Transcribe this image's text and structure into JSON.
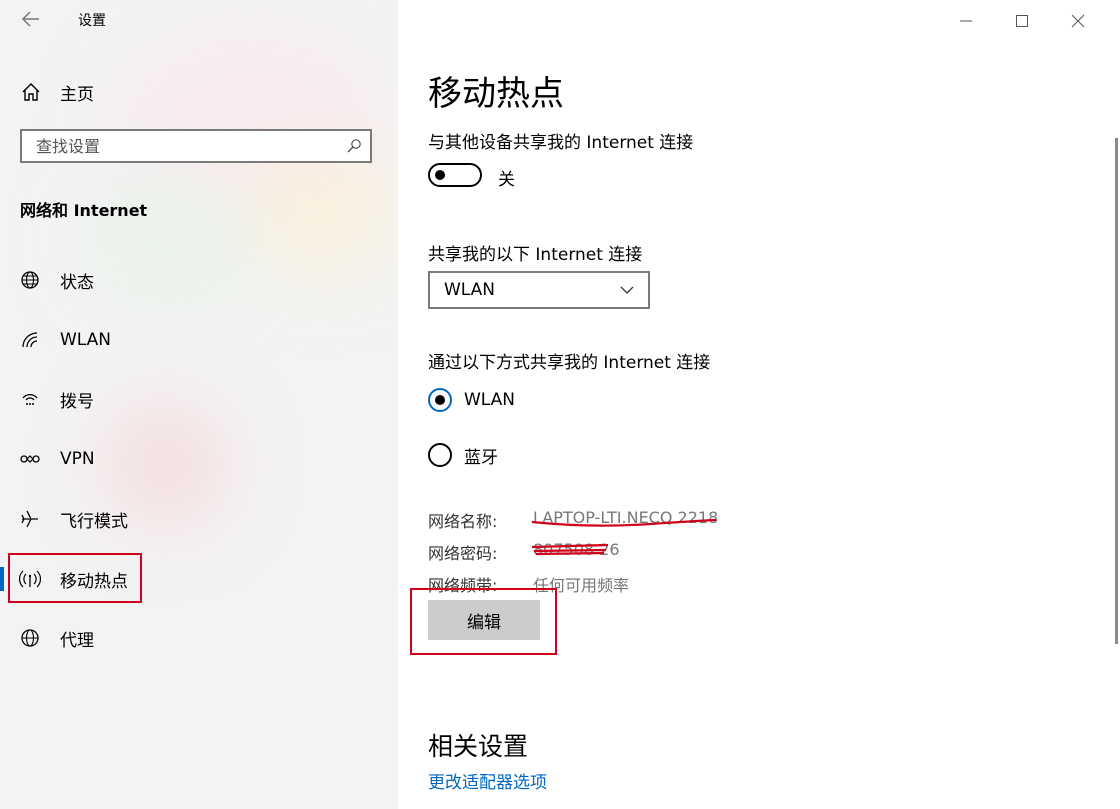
{
  "window": {
    "title": "设置"
  },
  "sidebar": {
    "home_label": "主页",
    "search_placeholder": "查找设置",
    "section_title": "网络和 Internet",
    "items": [
      {
        "label": "状态",
        "icon": "globe-status-icon"
      },
      {
        "label": "WLAN",
        "icon": "wifi-icon"
      },
      {
        "label": "拨号",
        "icon": "dialup-icon"
      },
      {
        "label": "VPN",
        "icon": "vpn-icon"
      },
      {
        "label": "飞行模式",
        "icon": "airplane-icon"
      },
      {
        "label": "移动热点",
        "icon": "hotspot-icon",
        "active": true
      },
      {
        "label": "代理",
        "icon": "globe-proxy-icon"
      }
    ]
  },
  "main": {
    "title": "移动热点",
    "share_label": "与其他设备共享我的 Internet 连接",
    "toggle_state_label": "关",
    "share_from_label": "共享我的以下 Internet 连接",
    "share_from_value": "WLAN",
    "share_over_label": "通过以下方式共享我的 Internet 连接",
    "radio_options": [
      {
        "label": "WLAN",
        "checked": true
      },
      {
        "label": "蓝牙",
        "checked": false
      }
    ],
    "network_name_key": "网络名称:",
    "network_name_value": "LAPTOP-LTI.NECQ 2218",
    "network_password_key": "网络密码:",
    "network_password_value": "807508 26",
    "network_band_key": "网络频带:",
    "network_band_value": "任何可用频率",
    "edit_button_label": "编辑",
    "related_title": "相关设置",
    "related_link": "更改适配器选项"
  },
  "colors": {
    "accent": "#0067c0",
    "highlight_box": "#d0021b",
    "button_bg": "#cccccc"
  }
}
